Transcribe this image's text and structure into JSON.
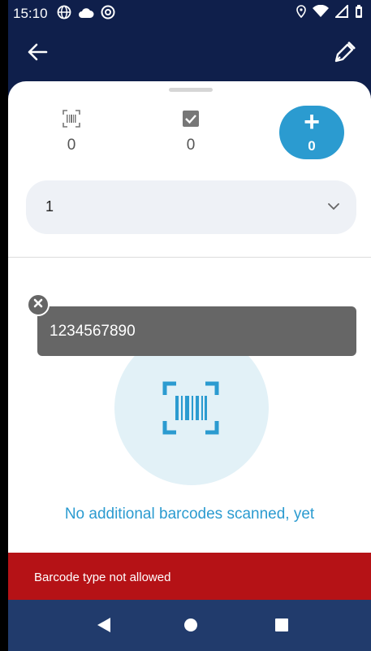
{
  "status_bar": {
    "time": "15:10",
    "icons_left": [
      "globe-icon",
      "cloud-icon",
      "at-icon"
    ],
    "icons_right": [
      "location-icon",
      "wifi-icon",
      "signal-icon",
      "battery-icon"
    ]
  },
  "app_bar": {
    "back_icon": "arrow-left-icon",
    "edit_icon": "pen-icon"
  },
  "counters": {
    "scanned": {
      "icon": "barcode-icon",
      "value": "0"
    },
    "checked": {
      "icon": "checkbox-icon",
      "value": "0"
    },
    "add": {
      "symbol": "+",
      "value": "0"
    }
  },
  "select": {
    "value": "1"
  },
  "barcode_chip": {
    "text": "1234567890"
  },
  "empty_state": {
    "text": "No additional barcodes scanned, yet"
  },
  "error_banner": {
    "text": "Barcode type not allowed"
  },
  "nav": {
    "back": "nav-back-icon",
    "home": "nav-home-icon",
    "recents": "nav-recents-icon"
  },
  "colors": {
    "header_bg": "#0f1f4b",
    "accent": "#2b9bd0",
    "error": "#b51216",
    "nav_bg": "#213b6c",
    "chip_bg": "#666666"
  }
}
